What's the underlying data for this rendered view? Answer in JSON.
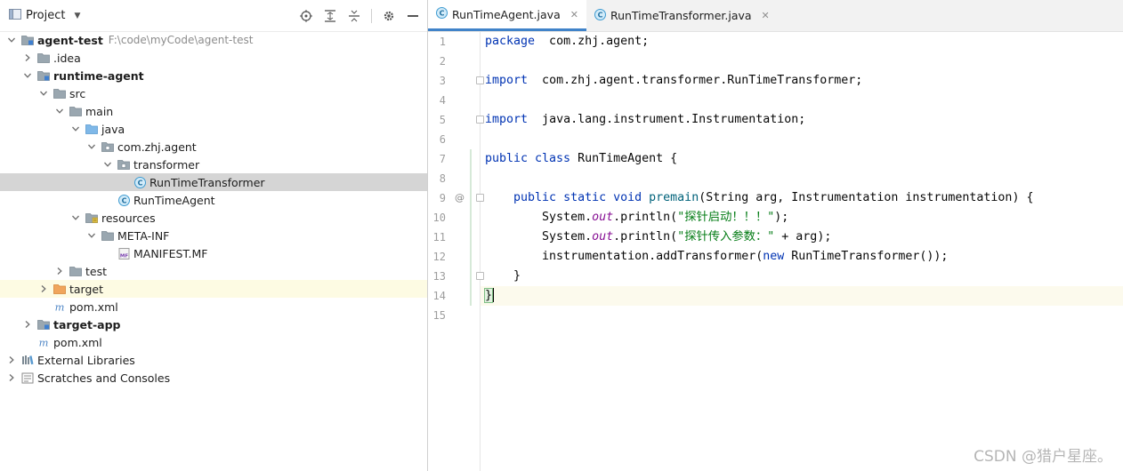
{
  "project_panel": {
    "title": "Project"
  },
  "tree": [
    {
      "label": "agent-test",
      "path": "F:\\code\\myCode\\agent-test",
      "bold": true,
      "depth": 0,
      "arrow": "down",
      "icon": "module-folder-icon"
    },
    {
      "label": ".idea",
      "depth": 1,
      "arrow": "right",
      "icon": "folder-icon"
    },
    {
      "label": "runtime-agent",
      "bold": true,
      "depth": 1,
      "arrow": "down",
      "icon": "module-folder-icon"
    },
    {
      "label": "src",
      "depth": 2,
      "arrow": "down",
      "icon": "folder-icon"
    },
    {
      "label": "main",
      "depth": 3,
      "arrow": "down",
      "icon": "folder-icon"
    },
    {
      "label": "java",
      "depth": 4,
      "arrow": "down",
      "icon": "source-folder-icon"
    },
    {
      "label": "com.zhj.agent",
      "depth": 5,
      "arrow": "down",
      "icon": "package-icon"
    },
    {
      "label": "transformer",
      "depth": 6,
      "arrow": "down",
      "icon": "package-icon"
    },
    {
      "label": "RunTimeTransformer",
      "depth": 7,
      "arrow": "none",
      "icon": "java-class-icon",
      "selected": true
    },
    {
      "label": "RunTimeAgent",
      "depth": 6,
      "arrow": "none",
      "icon": "java-class-icon"
    },
    {
      "label": "resources",
      "depth": 4,
      "arrow": "down",
      "icon": "resources-folder-icon"
    },
    {
      "label": "META-INF",
      "depth": 5,
      "arrow": "down",
      "icon": "folder-icon"
    },
    {
      "label": "MANIFEST.MF",
      "depth": 6,
      "arrow": "none",
      "icon": "manifest-file-icon"
    },
    {
      "label": "test",
      "depth": 3,
      "arrow": "right",
      "icon": "folder-icon"
    },
    {
      "label": "target",
      "depth": 2,
      "arrow": "right",
      "icon": "excluded-folder-icon",
      "highlight": true
    },
    {
      "label": "pom.xml",
      "depth": 2,
      "arrow": "none",
      "icon": "maven-icon"
    },
    {
      "label": "target-app",
      "bold": true,
      "depth": 1,
      "arrow": "right",
      "icon": "module-folder-icon"
    },
    {
      "label": "pom.xml",
      "depth": 1,
      "arrow": "none",
      "icon": "maven-icon"
    },
    {
      "label": "External Libraries",
      "depth": 0,
      "arrow": "right",
      "icon": "libraries-icon"
    },
    {
      "label": "Scratches and Consoles",
      "depth": 0,
      "arrow": "right",
      "icon": "scratches-icon"
    }
  ],
  "tabs": [
    {
      "label": "RunTimeAgent.java",
      "active": true
    },
    {
      "label": "RunTimeTransformer.java",
      "active": false
    }
  ],
  "code": [
    {
      "n": "1",
      "tokens": [
        [
          "kw",
          "package"
        ],
        [
          "",
          "  com.zhj.agent;"
        ]
      ]
    },
    {
      "n": "2",
      "tokens": []
    },
    {
      "n": "3",
      "tokens": [
        [
          "kw",
          "import"
        ],
        [
          "",
          "  com.zhj.agent.transformer.RunTimeTransformer;"
        ]
      ]
    },
    {
      "n": "4",
      "tokens": []
    },
    {
      "n": "5",
      "tokens": [
        [
          "kw",
          "import"
        ],
        [
          "",
          "  java.lang.instrument.Instrumentation;"
        ]
      ]
    },
    {
      "n": "6",
      "tokens": []
    },
    {
      "n": "7",
      "tokens": [
        [
          "kw",
          "public class"
        ],
        [
          "",
          " RunTimeAgent "
        ],
        [
          "brace",
          "{"
        ]
      ]
    },
    {
      "n": "8",
      "tokens": []
    },
    {
      "n": "9",
      "tokens": [
        [
          "",
          "    "
        ],
        [
          "kw",
          "public static void"
        ],
        [
          "",
          " "
        ],
        [
          "fn",
          "premain"
        ],
        [
          "",
          "(String arg, Instrumentation instrumentation) {"
        ]
      ]
    },
    {
      "n": "10",
      "tokens": [
        [
          "",
          "        System."
        ],
        [
          "fld",
          "out"
        ],
        [
          "",
          ".println("
        ],
        [
          "st",
          "\"探针启动！！！\""
        ],
        [
          "",
          ");"
        ]
      ]
    },
    {
      "n": "11",
      "tokens": [
        [
          "",
          "        System."
        ],
        [
          "fld",
          "out"
        ],
        [
          "",
          ".println("
        ],
        [
          "st",
          "\"探针传入参数：\""
        ],
        [
          "",
          " + arg);"
        ]
      ]
    },
    {
      "n": "12",
      "tokens": [
        [
          "",
          "        instrumentation.addTransformer("
        ],
        [
          "kw",
          "new"
        ],
        [
          "",
          " RunTimeTransformer());"
        ]
      ]
    },
    {
      "n": "13",
      "tokens": [
        [
          "",
          "    }"
        ]
      ]
    },
    {
      "n": "14",
      "tokens": [
        [
          "brace",
          "}"
        ]
      ],
      "current": true
    },
    {
      "n": "15",
      "tokens": []
    }
  ],
  "gutter_marks": {
    "line9": "@"
  },
  "watermark": "CSDN @猎户星座。"
}
